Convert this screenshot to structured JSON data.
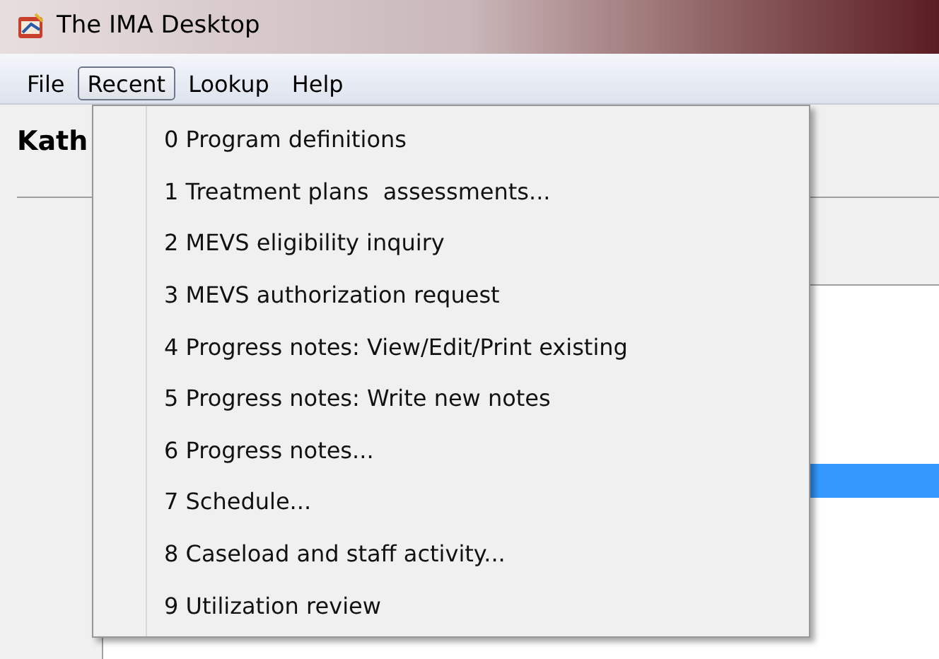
{
  "window": {
    "title": "The IMA Desktop"
  },
  "menu_bar": [
    {
      "label": "File",
      "selected": false
    },
    {
      "label": "Recent",
      "selected": true
    },
    {
      "label": "Lookup",
      "selected": false
    },
    {
      "label": "Help",
      "selected": false
    }
  ],
  "header": {
    "name": "Kath"
  },
  "recent_menu": {
    "items": [
      "0 Program definitions",
      "1 Treatment plans  assessments...",
      "2 MEVS eligibility inquiry",
      "3 MEVS authorization request",
      "4 Progress notes: View/Edit/Print existing",
      "5 Progress notes: Write new notes",
      "6 Progress notes...",
      "7 Schedule...",
      "8 Caseload and staff activity...",
      "9 Utilization review"
    ]
  }
}
